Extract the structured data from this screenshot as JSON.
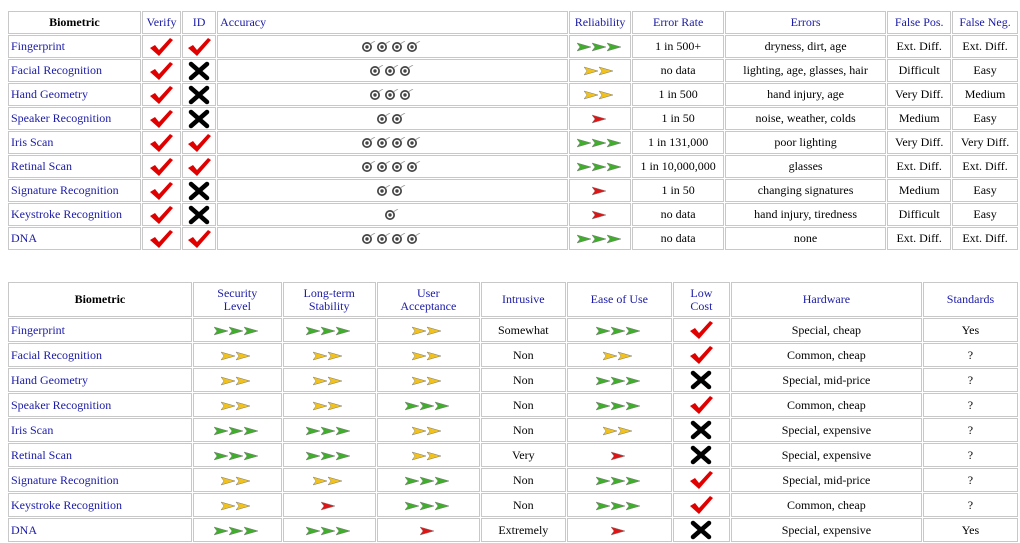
{
  "table1": {
    "headers": [
      "Biometric",
      "Verify",
      "ID",
      "Accuracy",
      "Reliability",
      "Error Rate",
      "Errors",
      "False Pos.",
      "False Neg."
    ],
    "rows": [
      {
        "name": "Fingerprint",
        "verify": "check",
        "id": "check",
        "accuracy": 4,
        "reliability": 3,
        "error_rate": "1 in 500+",
        "errors": "dryness, dirt, age",
        "false_pos": "Ext. Diff.",
        "false_neg": "Ext. Diff."
      },
      {
        "name": "Facial Recognition",
        "verify": "check",
        "id": "cross",
        "accuracy": 3,
        "reliability": 2,
        "error_rate": "no data",
        "errors": "lighting, age, glasses, hair",
        "false_pos": "Difficult",
        "false_neg": "Easy"
      },
      {
        "name": "Hand Geometry",
        "verify": "check",
        "id": "cross",
        "accuracy": 3,
        "reliability": 2,
        "error_rate": "1 in 500",
        "errors": "hand injury, age",
        "false_pos": "Very Diff.",
        "false_neg": "Medium"
      },
      {
        "name": "Speaker Recognition",
        "verify": "check",
        "id": "cross",
        "accuracy": 2,
        "reliability": 1,
        "error_rate": "1 in 50",
        "errors": "noise, weather, colds",
        "false_pos": "Medium",
        "false_neg": "Easy"
      },
      {
        "name": "Iris Scan",
        "verify": "check",
        "id": "check",
        "accuracy": 4,
        "reliability": 3,
        "error_rate": "1 in 131,000",
        "errors": "poor lighting",
        "false_pos": "Very Diff.",
        "false_neg": "Very Diff."
      },
      {
        "name": "Retinal Scan",
        "verify": "check",
        "id": "check",
        "accuracy": 4,
        "reliability": 3,
        "error_rate": "1 in 10,000,000",
        "errors": "glasses",
        "false_pos": "Ext. Diff.",
        "false_neg": "Ext. Diff."
      },
      {
        "name": "Signature Recognition",
        "verify": "check",
        "id": "cross",
        "accuracy": 2,
        "reliability": 1,
        "error_rate": "1 in 50",
        "errors": "changing signatures",
        "false_pos": "Medium",
        "false_neg": "Easy"
      },
      {
        "name": "Keystroke Recognition",
        "verify": "check",
        "id": "cross",
        "accuracy": 1,
        "reliability": 1,
        "error_rate": "no data",
        "errors": "hand injury, tiredness",
        "false_pos": "Difficult",
        "false_neg": "Easy"
      },
      {
        "name": "DNA",
        "verify": "check",
        "id": "check",
        "accuracy": 4,
        "reliability": 3,
        "error_rate": "no data",
        "errors": "none",
        "false_pos": "Ext. Diff.",
        "false_neg": "Ext. Diff."
      }
    ]
  },
  "table2": {
    "headers": {
      "biometric": "Biometric",
      "security_1": "Security",
      "security_2": "Level",
      "stability_1": "Long-term",
      "stability_2": "Stability",
      "acceptance_1": "User",
      "acceptance_2": "Acceptance",
      "intrusive": "Intrusive",
      "ease": "Ease of Use",
      "cost_1": "Low",
      "cost_2": "Cost",
      "hardware": "Hardware",
      "standards": "Standards"
    },
    "rows": [
      {
        "name": "Fingerprint",
        "security": 3,
        "stability": 3,
        "acceptance": 2,
        "intrusive": "Somewhat",
        "ease": 3,
        "low_cost": "check",
        "hardware": "Special, cheap",
        "standards": "Yes"
      },
      {
        "name": "Facial Recognition",
        "security": 2,
        "stability": 2,
        "acceptance": 2,
        "intrusive": "Non",
        "ease": 2,
        "low_cost": "check",
        "hardware": "Common, cheap",
        "standards": "?"
      },
      {
        "name": "Hand Geometry",
        "security": 2,
        "stability": 2,
        "acceptance": 2,
        "intrusive": "Non",
        "ease": 3,
        "low_cost": "cross",
        "hardware": "Special, mid-price",
        "standards": "?"
      },
      {
        "name": "Speaker Recognition",
        "security": 2,
        "stability": 2,
        "acceptance": 3,
        "intrusive": "Non",
        "ease": 3,
        "low_cost": "check",
        "hardware": "Common, cheap",
        "standards": "?"
      },
      {
        "name": "Iris Scan",
        "security": 3,
        "stability": 3,
        "acceptance": 2,
        "intrusive": "Non",
        "ease": 2,
        "low_cost": "cross",
        "hardware": "Special, expensive",
        "standards": "?"
      },
      {
        "name": "Retinal Scan",
        "security": 3,
        "stability": 3,
        "acceptance": 2,
        "intrusive": "Very",
        "ease": 1,
        "low_cost": "cross",
        "hardware": "Special, expensive",
        "standards": "?"
      },
      {
        "name": "Signature Recognition",
        "security": 2,
        "stability": 2,
        "acceptance": 3,
        "intrusive": "Non",
        "ease": 3,
        "low_cost": "check",
        "hardware": "Special, mid-price",
        "standards": "?"
      },
      {
        "name": "Keystroke Recognition",
        "security": 2,
        "stability": 1,
        "acceptance": 3,
        "intrusive": "Non",
        "ease": 3,
        "low_cost": "check",
        "hardware": "Common, cheap",
        "standards": "?"
      },
      {
        "name": "DNA",
        "security": 3,
        "stability": 3,
        "acceptance": 1,
        "intrusive": "Extremely",
        "ease": 1,
        "low_cost": "cross",
        "hardware": "Special, expensive",
        "standards": "Yes"
      }
    ]
  },
  "colors": {
    "link": "#1a1aa6",
    "arrow_green": "#3fae2a",
    "arrow_yellow": "#f2c21a",
    "arrow_red": "#e01414",
    "check": "#e00000",
    "cross": "#000000",
    "border": "#c8c8c8"
  },
  "icons": {
    "check": "red-checkmark-icon",
    "cross": "black-x-icon",
    "accuracy": "target-icon",
    "arrow": "arrow-rating-icon"
  }
}
